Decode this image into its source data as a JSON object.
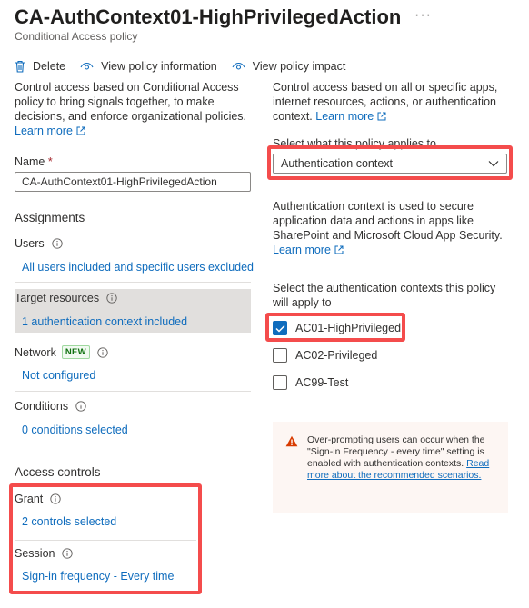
{
  "header": {
    "title": "CA-AuthContext01-HighPrivilegedAction",
    "more_label": "···",
    "subtitle": "Conditional Access policy"
  },
  "toolbar": {
    "delete_label": "Delete",
    "view_info_label": "View policy information",
    "view_impact_label": "View policy impact"
  },
  "left": {
    "intro": "Control access based on Conditional Access policy to bring signals together, to make decisions, and enforce organizational policies.",
    "learn_more": "Learn more",
    "name_label": "Name",
    "required_mark": "*",
    "name_value": "CA-AuthContext01-HighPrivilegedAction",
    "assignments_heading": "Assignments",
    "users_label": "Users",
    "users_value": "All users included and specific users excluded",
    "target_label": "Target resources",
    "target_value": "1 authentication context included",
    "network_label": "Network",
    "network_badge": "NEW",
    "network_value": "Not configured",
    "conditions_label": "Conditions",
    "conditions_value": "0 conditions selected",
    "access_heading": "Access controls",
    "grant_label": "Grant",
    "grant_value": "2 controls selected",
    "session_label": "Session",
    "session_value": "Sign-in frequency - Every time"
  },
  "right": {
    "intro": "Control access based on all or specific apps, internet resources, actions, or authentication context.",
    "learn_more": "Learn more",
    "select_label": "Select what this policy applies to",
    "dropdown_value": "Authentication context",
    "ac_desc": "Authentication context is used to secure application data and actions in apps like SharePoint and Microsoft Cloud App Security.",
    "learn_more2": "Learn more",
    "ac_select_label": "Select the authentication contexts this policy will apply to",
    "contexts": [
      {
        "label": "AC01-HighPrivileged",
        "checked": true
      },
      {
        "label": "AC02-Privileged",
        "checked": false
      },
      {
        "label": "AC99-Test",
        "checked": false
      }
    ],
    "warning_text": "Over-prompting users can occur when the \"Sign-in Frequency - every time\" setting is enabled with authentication contexts.",
    "warning_link": "Read more about the recommended scenarios."
  },
  "colors": {
    "accent": "#0f6cbd",
    "highlight": "#f44c4c",
    "warning": "#d83b01",
    "new_badge": "#0e700e"
  },
  "icons": {
    "delete": "trash-icon",
    "view": "eye-icon",
    "info": "info-icon",
    "external": "external-link-icon",
    "dropdown": "chevron-down-icon",
    "checkbox": "checkmark-icon",
    "warning": "warning-icon"
  }
}
